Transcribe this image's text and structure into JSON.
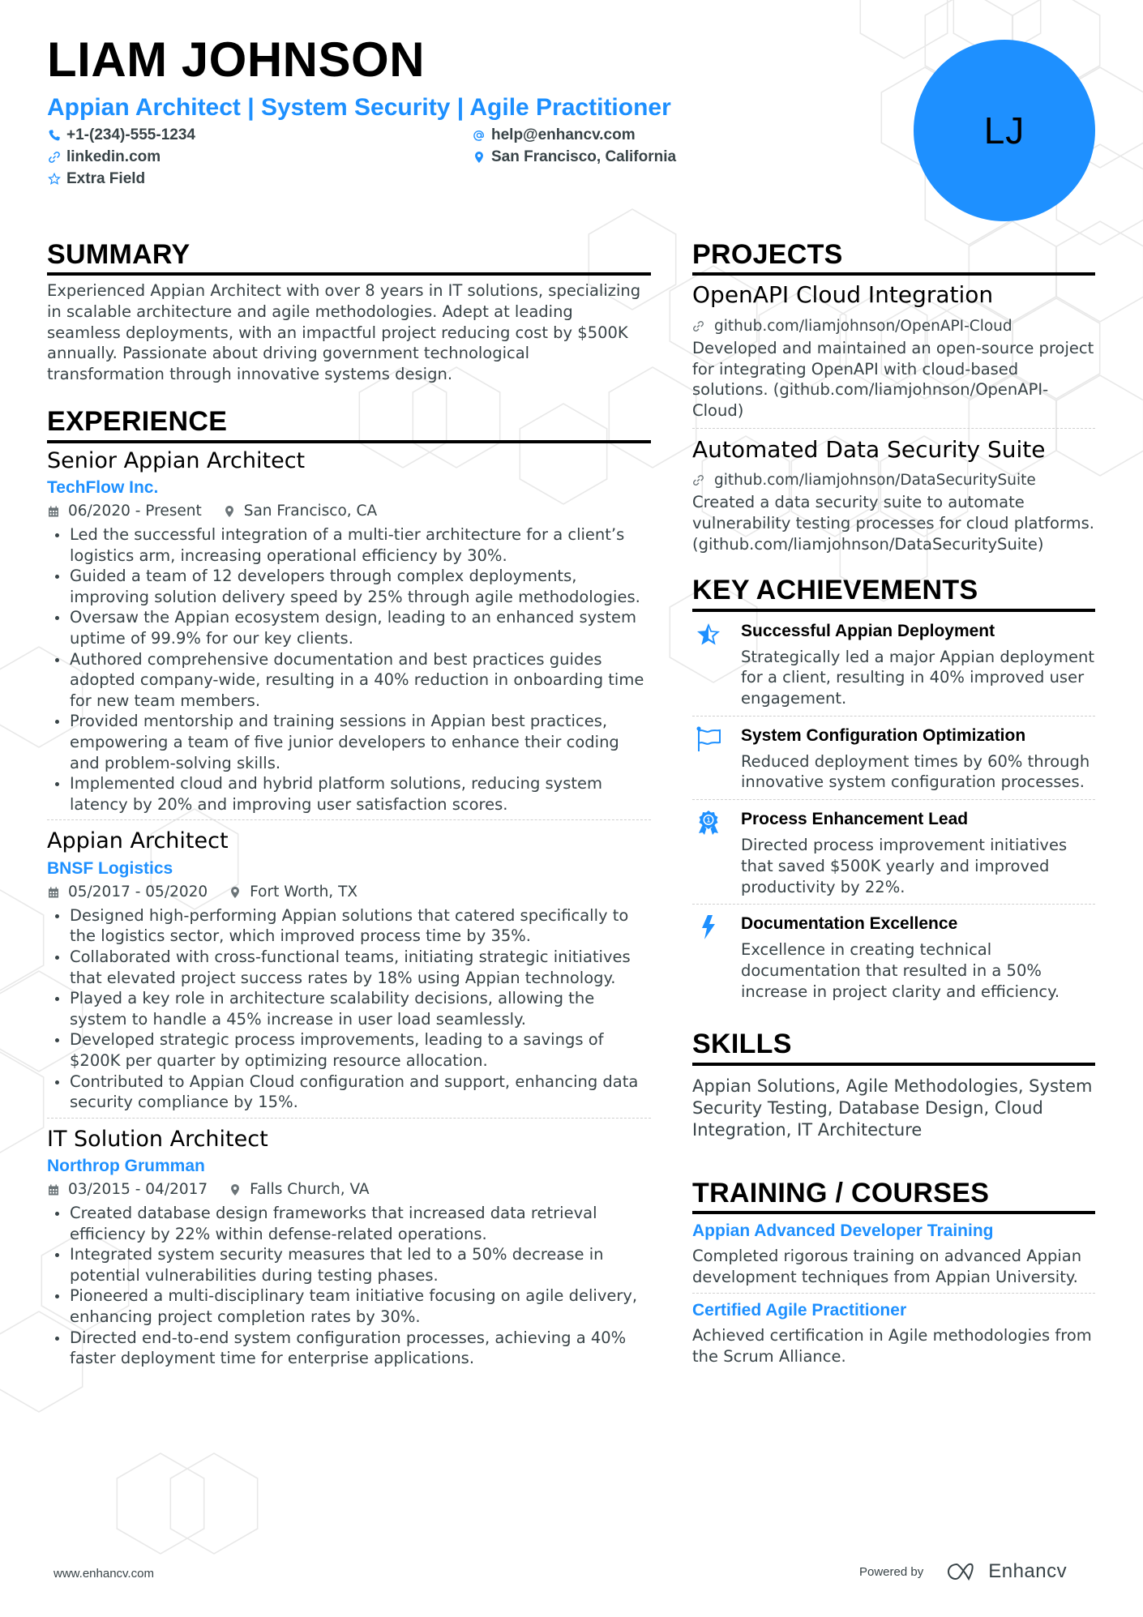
{
  "header": {
    "name": "LIAM JOHNSON",
    "headline": "Appian Architect | System Security | Agile Practitioner",
    "avatar_initials": "LJ",
    "contacts": {
      "phone": "+1-(234)-555-1234",
      "email": "help@enhancv.com",
      "linkedin": "linkedin.com",
      "location": "San Francisco, California",
      "extra": "Extra Field"
    }
  },
  "summary": {
    "title": "SUMMARY",
    "text": "Experienced Appian Architect with over 8 years in IT solutions, specializing in scalable architecture and agile methodologies. Adept at leading seamless deployments, with an impactful project reducing cost by $500K annually. Passionate about driving government technological transformation through innovative systems design."
  },
  "experience": {
    "title": "EXPERIENCE",
    "jobs": [
      {
        "title": "Senior Appian Architect",
        "company": "TechFlow Inc.",
        "dates": "06/2020 - Present",
        "location": "San Francisco, CA",
        "bullets": [
          "Led the successful integration of a multi-tier architecture for a client’s logistics arm, increasing operational efficiency by 30%.",
          "Guided a team of 12 developers through complex deployments, improving solution delivery speed by 25% through agile methodologies.",
          "Oversaw the Appian ecosystem design, leading to an enhanced system uptime of 99.9% for our key clients.",
          "Authored comprehensive documentation and best practices guides adopted company-wide, resulting in a 40% reduction in onboarding time for new team members.",
          "Provided mentorship and training sessions in Appian best practices, empowering a team of five junior developers to enhance their coding and problem-solving skills.",
          "Implemented cloud and hybrid platform solutions, reducing system latency by 20% and improving user satisfaction scores."
        ]
      },
      {
        "title": "Appian Architect",
        "company": "BNSF Logistics",
        "dates": "05/2017 - 05/2020",
        "location": "Fort Worth, TX",
        "bullets": [
          "Designed high-performing Appian solutions that catered specifically to the logistics sector, which improved process time by 35%.",
          "Collaborated with cross-functional teams, initiating strategic initiatives that elevated project success rates by 18% using Appian technology.",
          "Played a key role in architecture scalability decisions, allowing the system to handle a 45% increase in user load seamlessly.",
          "Developed strategic process improvements, leading to a savings of $200K per quarter by optimizing resource allocation.",
          "Contributed to Appian Cloud configuration and support, enhancing data security compliance by 15%."
        ]
      },
      {
        "title": "IT Solution Architect",
        "company": "Northrop Grumman",
        "dates": "03/2015 - 04/2017",
        "location": "Falls Church, VA",
        "bullets": [
          "Created database design frameworks that increased data retrieval efficiency by 22% within defense-related operations.",
          "Integrated system security measures that led to a 50% decrease in potential vulnerabilities during testing phases.",
          "Pioneered a multi-disciplinary team initiative focusing on agile delivery, enhancing project completion rates by 30%.",
          "Directed end-to-end system configuration processes, achieving a 40% faster deployment time for enterprise applications."
        ]
      }
    ]
  },
  "projects": {
    "title": "PROJECTS",
    "items": [
      {
        "title": "OpenAPI Cloud Integration",
        "link": "github.com/liamjohnson/OpenAPI-Cloud",
        "description": "Developed and maintained an open-source project for integrating OpenAPI with cloud-based solutions. (github.com/liamjohnson/OpenAPI-Cloud)"
      },
      {
        "title": "Automated Data Security Suite",
        "link": "github.com/liamjohnson/DataSecuritySuite",
        "description": "Created a data security suite to automate vulnerability testing processes for cloud platforms. (github.com/liamjohnson/DataSecuritySuite)"
      }
    ]
  },
  "achievements": {
    "title": "KEY ACHIEVEMENTS",
    "items": [
      {
        "icon": "star-icon",
        "title": "Successful Appian Deployment",
        "description": "Strategically led a major Appian deployment for a client, resulting in 40% improved user engagement."
      },
      {
        "icon": "flag-icon",
        "title": "System Configuration Optimization",
        "description": "Reduced deployment times by 60% through innovative system configuration processes."
      },
      {
        "icon": "award-ribbon-icon",
        "title": "Process Enhancement Lead",
        "description": "Directed process improvement initiatives that saved $500K yearly and improved productivity by 22%."
      },
      {
        "icon": "lightning-bolt-icon",
        "title": "Documentation Excellence",
        "description": "Excellence in creating technical documentation that resulted in a 50% increase in project clarity and efficiency."
      }
    ]
  },
  "skills": {
    "title": "SKILLS",
    "text": "Appian Solutions, Agile Methodologies, System Security Testing, Database Design, Cloud Integration, IT Architecture"
  },
  "training": {
    "title": "TRAINING / COURSES",
    "items": [
      {
        "title": "Appian Advanced Developer Training",
        "description": "Completed rigorous training on advanced Appian development techniques from Appian University."
      },
      {
        "title": "Certified Agile Practitioner",
        "description": "Achieved certification in Agile methodologies from the Scrum Alliance."
      }
    ]
  },
  "footer": {
    "website": "www.enhancv.com",
    "powered_by": "Powered by",
    "brand": "Enhancv"
  },
  "colors": {
    "accent": "#1e90ff",
    "text": "#384347",
    "heading": "#000000"
  }
}
